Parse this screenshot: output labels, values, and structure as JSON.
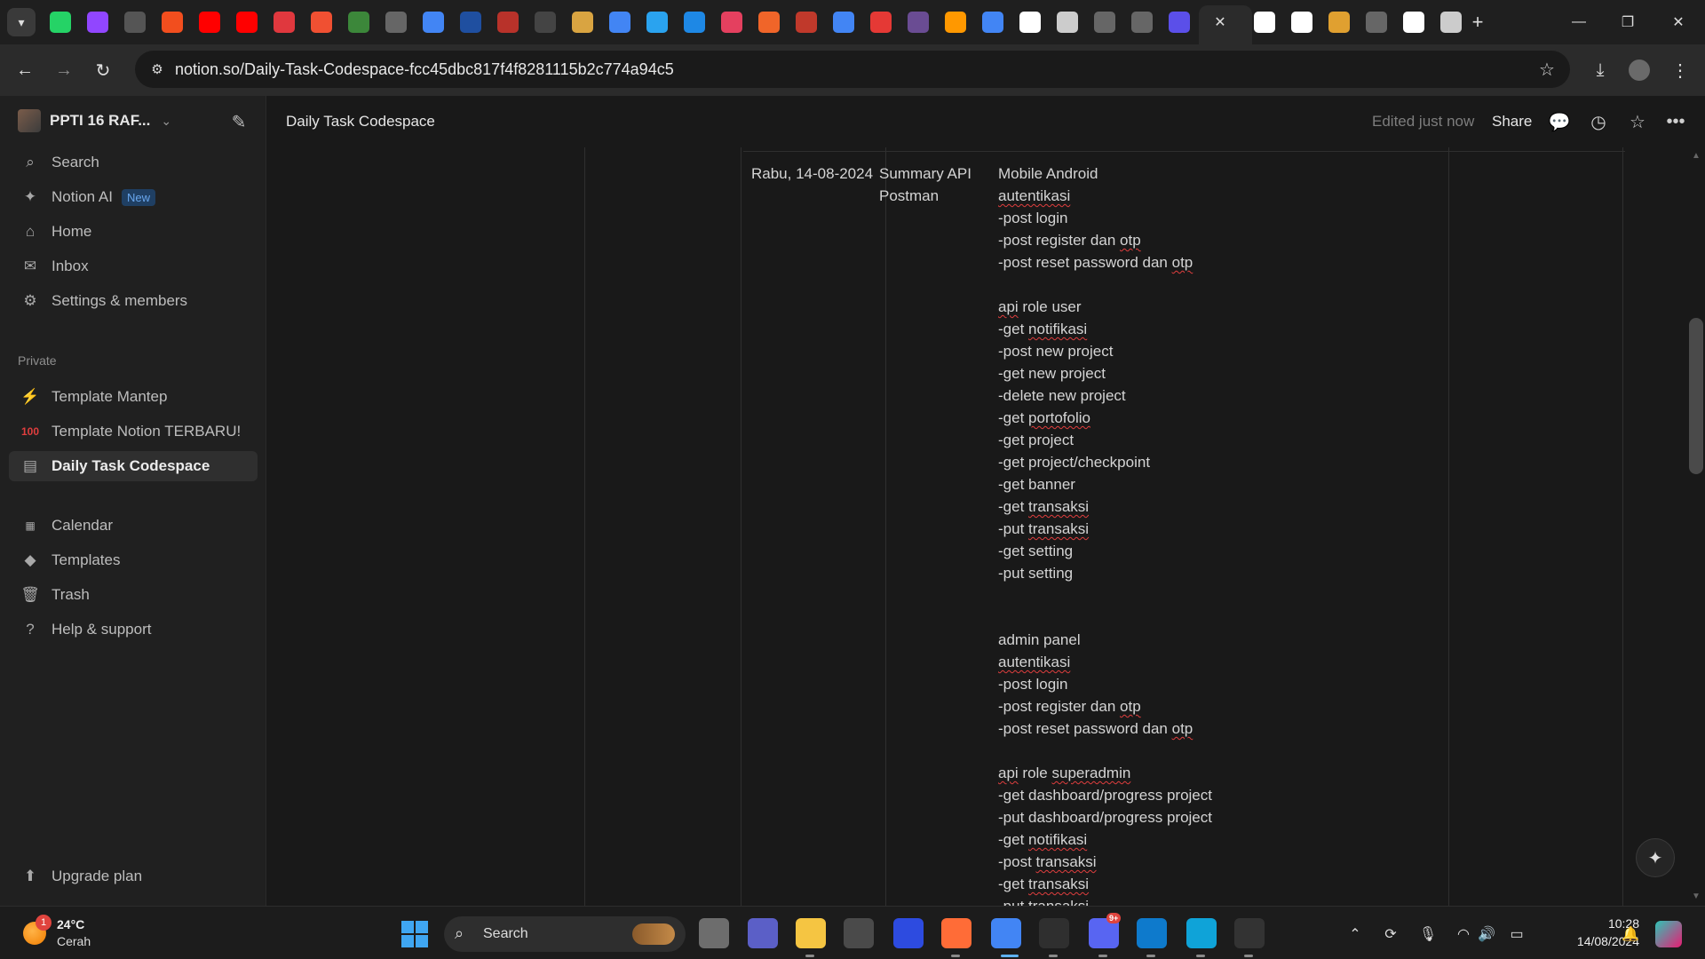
{
  "browser": {
    "tabs": [
      {
        "icon": "whatsapp-icon",
        "color": "#25d366"
      },
      {
        "icon": "twitch-icon",
        "color": "#9146ff"
      },
      {
        "icon": "eye-icon",
        "color": "#555555"
      },
      {
        "icon": "figma-icon",
        "color": "#f24e1e"
      },
      {
        "icon": "youtube-icon",
        "color": "#ff0000"
      },
      {
        "icon": "youtube-icon",
        "color": "#ff0000"
      },
      {
        "icon": "dicoding-icon",
        "color": "#e0383e"
      },
      {
        "icon": "git-icon",
        "color": "#f05032"
      },
      {
        "icon": "nodejs-icon",
        "color": "#3c873a"
      },
      {
        "icon": "globe-icon",
        "color": "#666666"
      },
      {
        "icon": "google-icon",
        "color": "#4285f4"
      },
      {
        "icon": "bfi-icon",
        "color": "#1f4fa0"
      },
      {
        "icon": "shield-icon",
        "color": "#b8322a"
      },
      {
        "icon": "film-icon",
        "color": "#444444"
      },
      {
        "icon": "er-icon",
        "color": "#d9a441"
      },
      {
        "icon": "google-icon",
        "color": "#4285f4"
      },
      {
        "icon": "telegram-icon",
        "color": "#2aa3ef"
      },
      {
        "icon": "app-icon",
        "color": "#1e88e5"
      },
      {
        "icon": "app-icon",
        "color": "#e4405f"
      },
      {
        "icon": "app-icon",
        "color": "#f06529"
      },
      {
        "icon": "app-icon",
        "color": "#c0392b"
      },
      {
        "icon": "google-icon",
        "color": "#4285f4"
      },
      {
        "icon": "app-icon",
        "color": "#e53935"
      },
      {
        "icon": "app-icon",
        "color": "#6a4c93"
      },
      {
        "icon": "app-icon",
        "color": "#ff9800"
      },
      {
        "icon": "google-icon",
        "color": "#4285f4"
      },
      {
        "icon": "notion-icon",
        "color": "#ffffff"
      },
      {
        "icon": "chatgpt-icon",
        "color": "#cccccc"
      },
      {
        "icon": "globe-icon",
        "color": "#666666"
      },
      {
        "icon": "globe-icon",
        "color": "#666666"
      },
      {
        "icon": "app-icon",
        "color": "#5b4fe9"
      },
      {
        "icon": "github-icon",
        "color": "#ffffff"
      },
      {
        "icon": "github-icon",
        "color": "#ffffff"
      },
      {
        "icon": "app-icon",
        "color": "#e0a030"
      },
      {
        "icon": "globe-icon",
        "color": "#666666"
      },
      {
        "icon": "chatgpt-icon",
        "color": "#ffffff"
      },
      {
        "icon": "chatgpt-icon",
        "color": "#cccccc"
      }
    ],
    "url": "notion.so/Daily-Task-Codespace-fcc45dbc817f4f8281115b2c774a94c5"
  },
  "sidebar": {
    "workspace_name": "PPTI 16 RAF...",
    "top_items": [
      {
        "label": "Search",
        "icon": "search-icon"
      },
      {
        "label": "Notion AI",
        "icon": "sparkle-icon",
        "badge": "New"
      },
      {
        "label": "Home",
        "icon": "home-icon"
      },
      {
        "label": "Inbox",
        "icon": "inbox-icon"
      },
      {
        "label": "Settings & members",
        "icon": "gear-icon"
      }
    ],
    "private_label": "Private",
    "pages": [
      {
        "label": "Template Mantep",
        "icon": "lightning-icon"
      },
      {
        "label": "Template Notion TERBARU!",
        "icon": "hundred-icon"
      },
      {
        "label": "Daily Task Codespace",
        "icon": "page-icon",
        "active": true
      }
    ],
    "bottom_items": [
      {
        "label": "Calendar",
        "icon": "calendar-icon"
      },
      {
        "label": "Templates",
        "icon": "templates-icon"
      },
      {
        "label": "Trash",
        "icon": "trash-icon"
      },
      {
        "label": "Help & support",
        "icon": "help-icon"
      }
    ],
    "upgrade_label": "Upgrade plan"
  },
  "header": {
    "page_title": "Daily Task Codespace",
    "edited": "Edited just now",
    "share": "Share"
  },
  "table": {
    "date": "Rabu, 14-08-2024",
    "topic": [
      "Summary API",
      "Postman"
    ],
    "task_lines": [
      {
        "text": "Mobile Android"
      },
      {
        "text": "autentikasi",
        "spell": "autentikasi"
      },
      {
        "text": "-post login"
      },
      {
        "prefix": "-post register dan ",
        "spell": "otp"
      },
      {
        "prefix": "-post reset password dan ",
        "spell": "otp"
      },
      {
        "text": ""
      },
      {
        "prefix": "",
        "spell": "api",
        "suffix": " role user"
      },
      {
        "prefix": "-get ",
        "spell": "notifikasi"
      },
      {
        "text": "-post new project"
      },
      {
        "text": "-get new project"
      },
      {
        "text": "-delete new project"
      },
      {
        "prefix": "-get ",
        "spell": "portofolio"
      },
      {
        "text": "-get project"
      },
      {
        "text": "-get project/checkpoint"
      },
      {
        "text": "-get banner"
      },
      {
        "prefix": "-get ",
        "spell": "transaksi"
      },
      {
        "prefix": "-put ",
        "spell": "transaksi"
      },
      {
        "text": "-get setting"
      },
      {
        "text": "-put setting"
      },
      {
        "text": ""
      },
      {
        "text": ""
      },
      {
        "text": "admin panel"
      },
      {
        "text": "autentikasi",
        "spell": "autentikasi"
      },
      {
        "text": "-post login"
      },
      {
        "prefix": "-post register dan ",
        "spell": "otp"
      },
      {
        "prefix": "-post reset password dan ",
        "spell": "otp"
      },
      {
        "text": ""
      },
      {
        "prefix": "",
        "spell": "api",
        "suffix": " role "
      },
      {
        "text": "-get dashboard/progress project"
      },
      {
        "text": "-put dashboard/progress project"
      },
      {
        "prefix": "-get ",
        "spell": "notifikasi"
      },
      {
        "prefix": "-post ",
        "spell": "transaksi"
      },
      {
        "prefix": "-get ",
        "spell": "transaksi"
      },
      {
        "prefix": "-put ",
        "spell": "transaksi"
      }
    ]
  },
  "taskbar": {
    "weather_temp": "24°C",
    "weather_desc": "Cerah",
    "weather_badge": "1",
    "search_label": "Search",
    "apps": [
      {
        "icon": "task-view-icon",
        "color": "#6d6d6d"
      },
      {
        "icon": "teams-icon",
        "color": "#5b5fc7"
      },
      {
        "icon": "file-explorer-icon",
        "color": "#f5c542"
      },
      {
        "icon": "camera-icon",
        "color": "#4a4a4a"
      },
      {
        "icon": "l-app-icon",
        "color": "#2d4be0"
      },
      {
        "icon": "postman-icon",
        "color": "#ff6c37"
      },
      {
        "icon": "chrome-icon",
        "color": "#4285f4"
      },
      {
        "icon": "terminal-icon",
        "color": "#2f2f2f"
      },
      {
        "icon": "discord-icon",
        "color": "#5865f2"
      },
      {
        "icon": "vscode-icon",
        "color": "#0e7acc"
      },
      {
        "icon": "edge-icon",
        "color": "#0fa3d8"
      },
      {
        "icon": "chatgpt-icon",
        "color": "#333333"
      }
    ],
    "discord_badge": "9+",
    "time": "10:28",
    "date": "14/08/2024"
  }
}
